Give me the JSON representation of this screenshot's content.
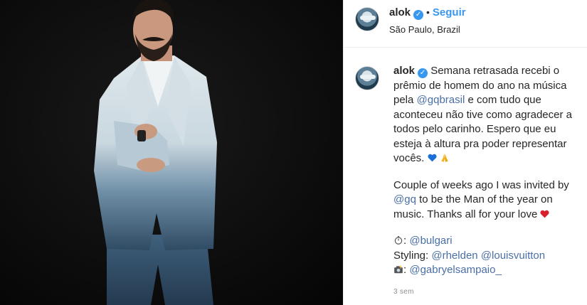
{
  "post": {
    "username": "alok",
    "follow_label": "Seguir",
    "location": "São Paulo, Brazil",
    "timestamp": "3 sem"
  },
  "caption": {
    "l1": "Semana retrasada recebi o",
    "l2": "prêmio de homem do ano na música",
    "l3_pre": "pela ",
    "l3_mention": "@gqbrasil",
    "l3_post": " e com tudo que",
    "l4": "aconteceu não tive como agradecer a",
    "l5": "todos pelo carinho. Espero que eu",
    "l6": "esteja à altura pra poder representar",
    "l7": "vocês.",
    "p2_l1": "Couple of weeks ago I was invited by",
    "p2_l2_mention": "@gq",
    "p2_l2_post": " to be the Man of the year on",
    "p2_l3": "music. Thanks all for your love",
    "credit_watch_mention": "@bulgari",
    "credit_styling_label": "Styling: ",
    "credit_styling_m1": "@rhelden",
    "credit_styling_m2": "@louisvuitton",
    "credit_photo_mention": "@gabryelsampaio_"
  },
  "icons": {
    "verified": "verified-badge-icon",
    "blue_heart": "blue-heart-emoji",
    "pray": "folded-hands-emoji",
    "red_heart": "red-heart-emoji",
    "stopwatch": "stopwatch-emoji",
    "camera": "camera-flash-emoji"
  },
  "colors": {
    "link": "#3897f0",
    "mention": "#4a6fa5",
    "text": "#262626",
    "muted": "#8e8e8e"
  }
}
